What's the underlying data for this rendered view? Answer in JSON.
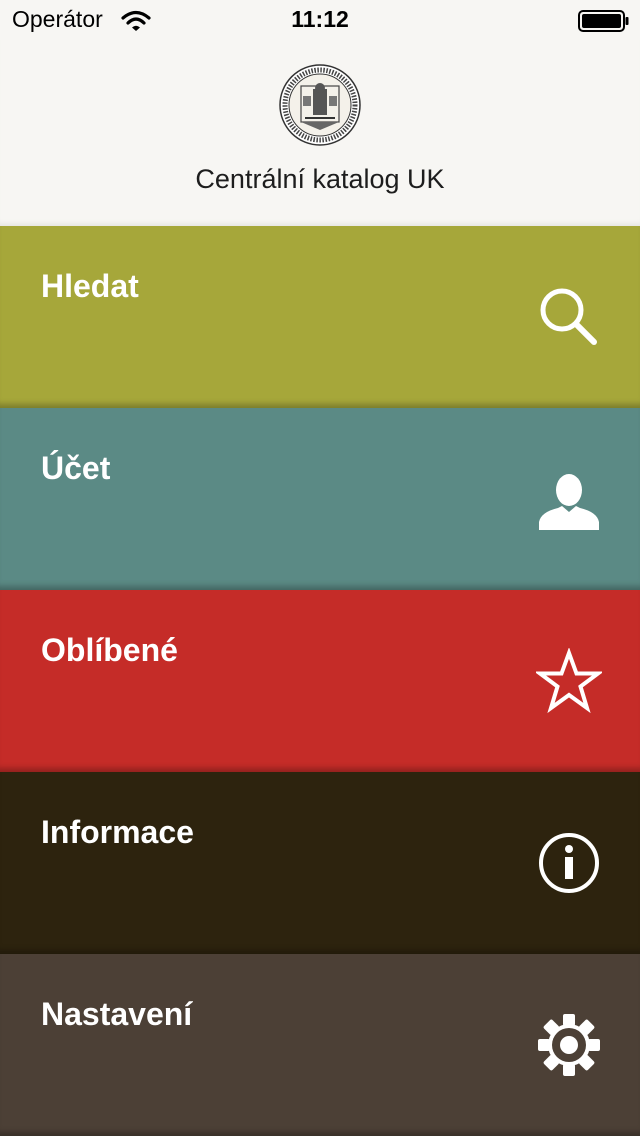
{
  "status_bar": {
    "carrier": "Operátor",
    "time": "11:12"
  },
  "header": {
    "title": "Centrální katalog UK",
    "logo_icon": "university-seal-icon"
  },
  "menu": {
    "items": [
      {
        "label": "Hledat",
        "color": "#a6a73a",
        "icon": "search-icon"
      },
      {
        "label": "Účet",
        "color": "#5b8a85",
        "icon": "user-icon"
      },
      {
        "label": "Oblíbené",
        "color": "#c52c28",
        "icon": "star-icon"
      },
      {
        "label": "Informace",
        "color": "#2d230e",
        "icon": "info-icon"
      },
      {
        "label": "Nastavení",
        "color": "#4c4036",
        "icon": "gear-icon"
      }
    ]
  }
}
